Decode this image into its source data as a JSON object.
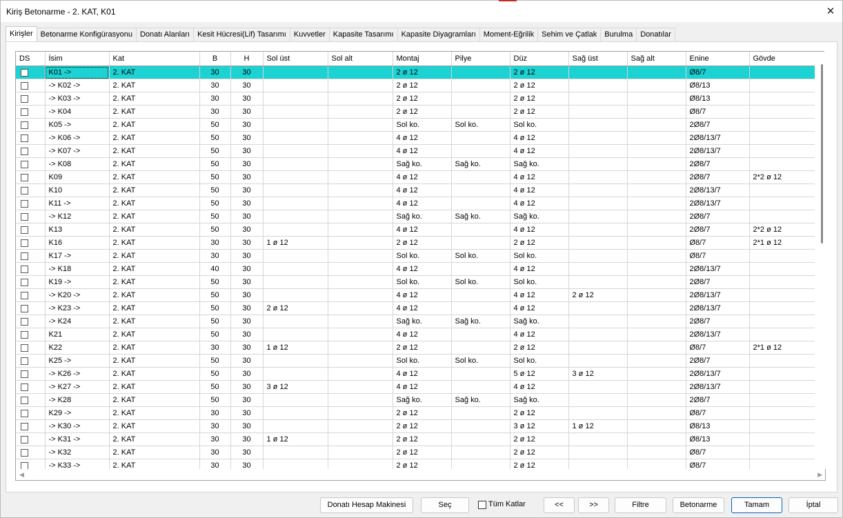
{
  "window": {
    "title": "Kiriş Betonarme - 2. KAT, K01",
    "close_glyph": "✕"
  },
  "tabs": [
    {
      "label": "Kirişler",
      "active": true
    },
    {
      "label": "Betonarme Konfigürasyonu"
    },
    {
      "label": "Donatı Alanları"
    },
    {
      "label": "Kesit Hücresi(Lif) Tasarımı"
    },
    {
      "label": "Kuvvetler"
    },
    {
      "label": "Kapasite Tasarımı"
    },
    {
      "label": "Kapasite Diyagramları"
    },
    {
      "label": "Moment-Eğrilik"
    },
    {
      "label": "Sehim ve Çatlak"
    },
    {
      "label": "Burulma"
    },
    {
      "label": "Donatılar"
    }
  ],
  "table": {
    "columns": [
      "DS",
      "İsim",
      "Kat",
      "B",
      "H",
      "Sol üst",
      "Sol alt",
      "Montaj",
      "Pilye",
      "Düz",
      "Sağ üst",
      "Sağ alt",
      "Enine",
      "Gövde"
    ],
    "selected_row": 0,
    "rows": [
      [
        "",
        "K01 ->",
        "2. KAT",
        "30",
        "30",
        "",
        "",
        "2 ø 12",
        "",
        "2 ø 12",
        "",
        "",
        "Ø8/7",
        ""
      ],
      [
        "",
        "-> K02 ->",
        "2. KAT",
        "30",
        "30",
        "",
        "",
        "2 ø 12",
        "",
        "2 ø 12",
        "",
        "",
        "Ø8/13",
        ""
      ],
      [
        "",
        "-> K03 ->",
        "2. KAT",
        "30",
        "30",
        "",
        "",
        "2 ø 12",
        "",
        "2 ø 12",
        "",
        "",
        "Ø8/13",
        ""
      ],
      [
        "",
        "-> K04",
        "2. KAT",
        "30",
        "30",
        "",
        "",
        "2 ø 12",
        "",
        "2 ø 12",
        "",
        "",
        "Ø8/7",
        ""
      ],
      [
        "",
        "K05 ->",
        "2. KAT",
        "50",
        "30",
        "",
        "",
        "Sol ko.",
        "Sol ko.",
        "Sol ko.",
        "",
        "",
        "2Ø8/7",
        ""
      ],
      [
        "",
        "-> K06 ->",
        "2. KAT",
        "50",
        "30",
        "",
        "",
        "4 ø 12",
        "",
        "4 ø 12",
        "",
        "",
        "2Ø8/13/7",
        ""
      ],
      [
        "",
        "-> K07 ->",
        "2. KAT",
        "50",
        "30",
        "",
        "",
        "4 ø 12",
        "",
        "4 ø 12",
        "",
        "",
        "2Ø8/13/7",
        ""
      ],
      [
        "",
        "-> K08",
        "2. KAT",
        "50",
        "30",
        "",
        "",
        "Sağ ko.",
        "Sağ ko.",
        "Sağ ko.",
        "",
        "",
        "2Ø8/7",
        ""
      ],
      [
        "",
        "K09",
        "2. KAT",
        "50",
        "30",
        "",
        "",
        "4 ø 12",
        "",
        "4 ø 12",
        "",
        "",
        "2Ø8/7",
        "2*2 ø 12"
      ],
      [
        "",
        "K10",
        "2. KAT",
        "50",
        "30",
        "",
        "",
        "4 ø 12",
        "",
        "4 ø 12",
        "",
        "",
        "2Ø8/13/7",
        ""
      ],
      [
        "",
        "K11 ->",
        "2. KAT",
        "50",
        "30",
        "",
        "",
        "4 ø 12",
        "",
        "4 ø 12",
        "",
        "",
        "2Ø8/13/7",
        ""
      ],
      [
        "",
        "-> K12",
        "2. KAT",
        "50",
        "30",
        "",
        "",
        "Sağ ko.",
        "Sağ ko.",
        "Sağ ko.",
        "",
        "",
        "2Ø8/7",
        ""
      ],
      [
        "",
        "K13",
        "2. KAT",
        "50",
        "30",
        "",
        "",
        "4 ø 12",
        "",
        "4 ø 12",
        "",
        "",
        "2Ø8/7",
        "2*2 ø 12"
      ],
      [
        "",
        "K16",
        "2. KAT",
        "30",
        "30",
        "1 ø 12",
        "",
        "2 ø 12",
        "",
        "2 ø 12",
        "",
        "",
        "Ø8/7",
        "2*1 ø 12"
      ],
      [
        "",
        "K17 ->",
        "2. KAT",
        "30",
        "30",
        "",
        "",
        "Sol ko.",
        "Sol ko.",
        "Sol ko.",
        "",
        "",
        "Ø8/7",
        ""
      ],
      [
        "",
        "-> K18",
        "2. KAT",
        "40",
        "30",
        "",
        "",
        "4 ø 12",
        "",
        "4 ø 12",
        "",
        "",
        "2Ø8/13/7",
        ""
      ],
      [
        "",
        "K19 ->",
        "2. KAT",
        "50",
        "30",
        "",
        "",
        "Sol ko.",
        "Sol ko.",
        "Sol ko.",
        "",
        "",
        "2Ø8/7",
        ""
      ],
      [
        "",
        "-> K20 ->",
        "2. KAT",
        "50",
        "30",
        "",
        "",
        "4 ø 12",
        "",
        "4 ø 12",
        "2 ø 12",
        "",
        "2Ø8/13/7",
        ""
      ],
      [
        "",
        "-> K23 ->",
        "2. KAT",
        "50",
        "30",
        "2 ø 12",
        "",
        "4 ø 12",
        "",
        "4 ø 12",
        "",
        "",
        "2Ø8/13/7",
        ""
      ],
      [
        "",
        "-> K24",
        "2. KAT",
        "50",
        "30",
        "",
        "",
        "Sağ ko.",
        "Sağ ko.",
        "Sağ ko.",
        "",
        "",
        "2Ø8/7",
        ""
      ],
      [
        "",
        "K21",
        "2. KAT",
        "50",
        "30",
        "",
        "",
        "4 ø 12",
        "",
        "4 ø 12",
        "",
        "",
        "2Ø8/13/7",
        ""
      ],
      [
        "",
        "K22",
        "2. KAT",
        "30",
        "30",
        "1 ø 12",
        "",
        "2 ø 12",
        "",
        "2 ø 12",
        "",
        "",
        "Ø8/7",
        "2*1 ø 12"
      ],
      [
        "",
        "K25 ->",
        "2. KAT",
        "50",
        "30",
        "",
        "",
        "Sol ko.",
        "Sol ko.",
        "Sol ko.",
        "",
        "",
        "2Ø8/7",
        ""
      ],
      [
        "",
        "-> K26 ->",
        "2. KAT",
        "50",
        "30",
        "",
        "",
        "4 ø 12",
        "",
        "5 ø 12",
        "3 ø 12",
        "",
        "2Ø8/13/7",
        ""
      ],
      [
        "",
        "-> K27 ->",
        "2. KAT",
        "50",
        "30",
        "3 ø 12",
        "",
        "4 ø 12",
        "",
        "4 ø 12",
        "",
        "",
        "2Ø8/13/7",
        ""
      ],
      [
        "",
        "-> K28",
        "2. KAT",
        "50",
        "30",
        "",
        "",
        "Sağ ko.",
        "Sağ ko.",
        "Sağ ko.",
        "",
        "",
        "2Ø8/7",
        ""
      ],
      [
        "",
        "K29 ->",
        "2. KAT",
        "30",
        "30",
        "",
        "",
        "2 ø 12",
        "",
        "2 ø 12",
        "",
        "",
        "Ø8/7",
        ""
      ],
      [
        "",
        "-> K30 ->",
        "2. KAT",
        "30",
        "30",
        "",
        "",
        "2 ø 12",
        "",
        "3 ø 12",
        "1 ø 12",
        "",
        "Ø8/13",
        ""
      ],
      [
        "",
        "-> K31 ->",
        "2. KAT",
        "30",
        "30",
        "1 ø 12",
        "",
        "2 ø 12",
        "",
        "2 ø 12",
        "",
        "",
        "Ø8/13",
        ""
      ],
      [
        "",
        "-> K32",
        "2. KAT",
        "30",
        "30",
        "",
        "",
        "2 ø 12",
        "",
        "2 ø 12",
        "",
        "",
        "Ø8/7",
        ""
      ],
      [
        "",
        "-> K33 ->",
        "2. KAT",
        "30",
        "30",
        "",
        "",
        "2 ø 12",
        "",
        "2 ø 12",
        "",
        "",
        "Ø8/7",
        ""
      ]
    ]
  },
  "scroll": {
    "left_arrow": "◀",
    "right_arrow": "▶"
  },
  "buttons": {
    "donati_hesap": "Donatı Hesap Makinesi",
    "sec": "Seç",
    "tum_katlar": "Tüm Katlar",
    "prev": "<<",
    "next": ">>",
    "filtre": "Filtre",
    "betonarme": "Betonarme",
    "tamam": "Tamam",
    "iptal": "İptal"
  }
}
